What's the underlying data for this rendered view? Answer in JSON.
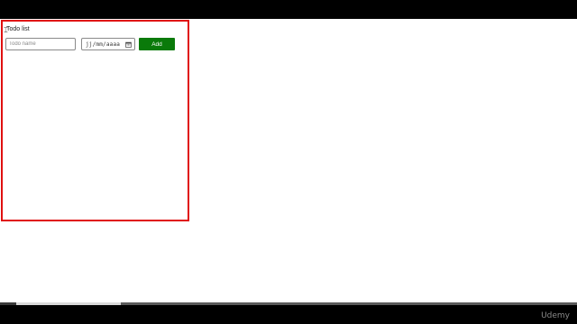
{
  "app": {
    "title": "Todo list",
    "name_input": {
      "value": "",
      "placeholder": "Todo name"
    },
    "date_input": {
      "display": "jj/mm/aaaa"
    },
    "add_button": {
      "label": "Add"
    }
  },
  "video_player": {
    "watermark": "Udemy",
    "progress_fraction": 0.21
  },
  "colors": {
    "frame_border": "#e01010",
    "add_button_bg": "#0a7a0a",
    "add_button_text": "#ffffff"
  },
  "icons": [
    "calendar-icon",
    "text-cursor-icon"
  ]
}
